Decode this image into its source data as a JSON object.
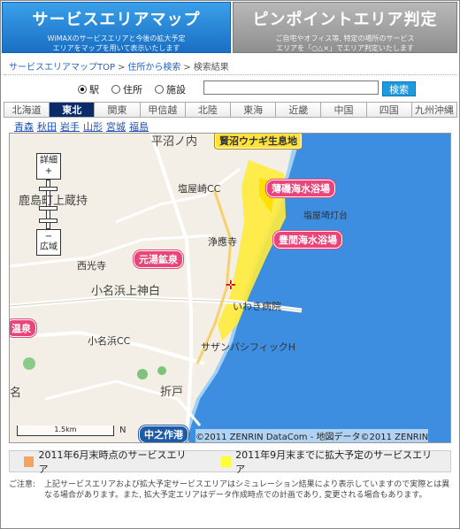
{
  "header": {
    "tab_wimax_title": "サービスエリアマップ",
    "tab_wimax_sub1": "WiMAXのサービスエリアと今後の拡大予定",
    "tab_wimax_sub2": "エリアをマップを用いて表示いたします",
    "tab_pin_title": "ピンポイントエリア判定",
    "tab_pin_sub1": "ご自宅やオフィス等, 特定の場所のサービス",
    "tab_pin_sub2": "エリアを「○△×」でエリア判定いたします"
  },
  "breadcrumb": {
    "item1": "サービスエリアマップTOP",
    "item2": "住所から検索",
    "item3": "検索結果",
    "separator": ">"
  },
  "search": {
    "radio_station": "駅",
    "radio_address": "住所",
    "radio_facility": "施設",
    "selected": "駅",
    "input_value": "",
    "button_label": "検索"
  },
  "regions": [
    "北海道",
    "東北",
    "関東",
    "甲信越",
    "北陸",
    "東海",
    "近畿",
    "中国",
    "四国",
    "九州沖縄"
  ],
  "active_region": "東北",
  "prefectures": [
    "青森",
    "秋田",
    "岩手",
    "山形",
    "宮城",
    "福島"
  ],
  "map": {
    "zoom_in_label": "詳細",
    "zoom_in_symbol": "+",
    "zoom_out_symbol": "−",
    "zoom_out_label": "広域",
    "labels": {
      "hiramachi": "平沼ノ内",
      "kashima": "鹿島町上蔵持",
      "shioyazaki": "塩屋崎CC",
      "jokoji": "浄應寺",
      "saikoji": "西光寺",
      "onahama": "小名浜上神白",
      "iwaki": "いわき病院",
      "onahama_cc": "小名浜CC",
      "lighthouse": "塩屋埼灯台",
      "pacific": "サザンパシフィックH",
      "orido": "折戸",
      "onsen_left": "温泉",
      "na": "名"
    },
    "pills": {
      "hotel": "賢沼ウナギ生息地",
      "beach1": "薄磯海水浴場",
      "beach2": "豊間海水浴場",
      "spa": "元湯鉱泉",
      "station": "中之作港"
    },
    "scale": "1.5km",
    "north": "N",
    "copyright": "©2011 ZENRIN DataCom - 地図データ©2011 ZENRIN"
  },
  "legend": {
    "item1": "2011年6月末時点のサービスエリア",
    "item2": "2011年9月末までに拡大予定のサービスエリア",
    "color1": "#f4a460",
    "color2": "#ffff33"
  },
  "note": {
    "head": "ご注意:",
    "text": "上記サービスエリアおよび拡大予定サービスエリアはシミュレーション結果により表示していますので実際とは異なる場合があります。また, 拡大予定エリアはデータ作成時点での計画であり, 変更される場合もあります。"
  }
}
